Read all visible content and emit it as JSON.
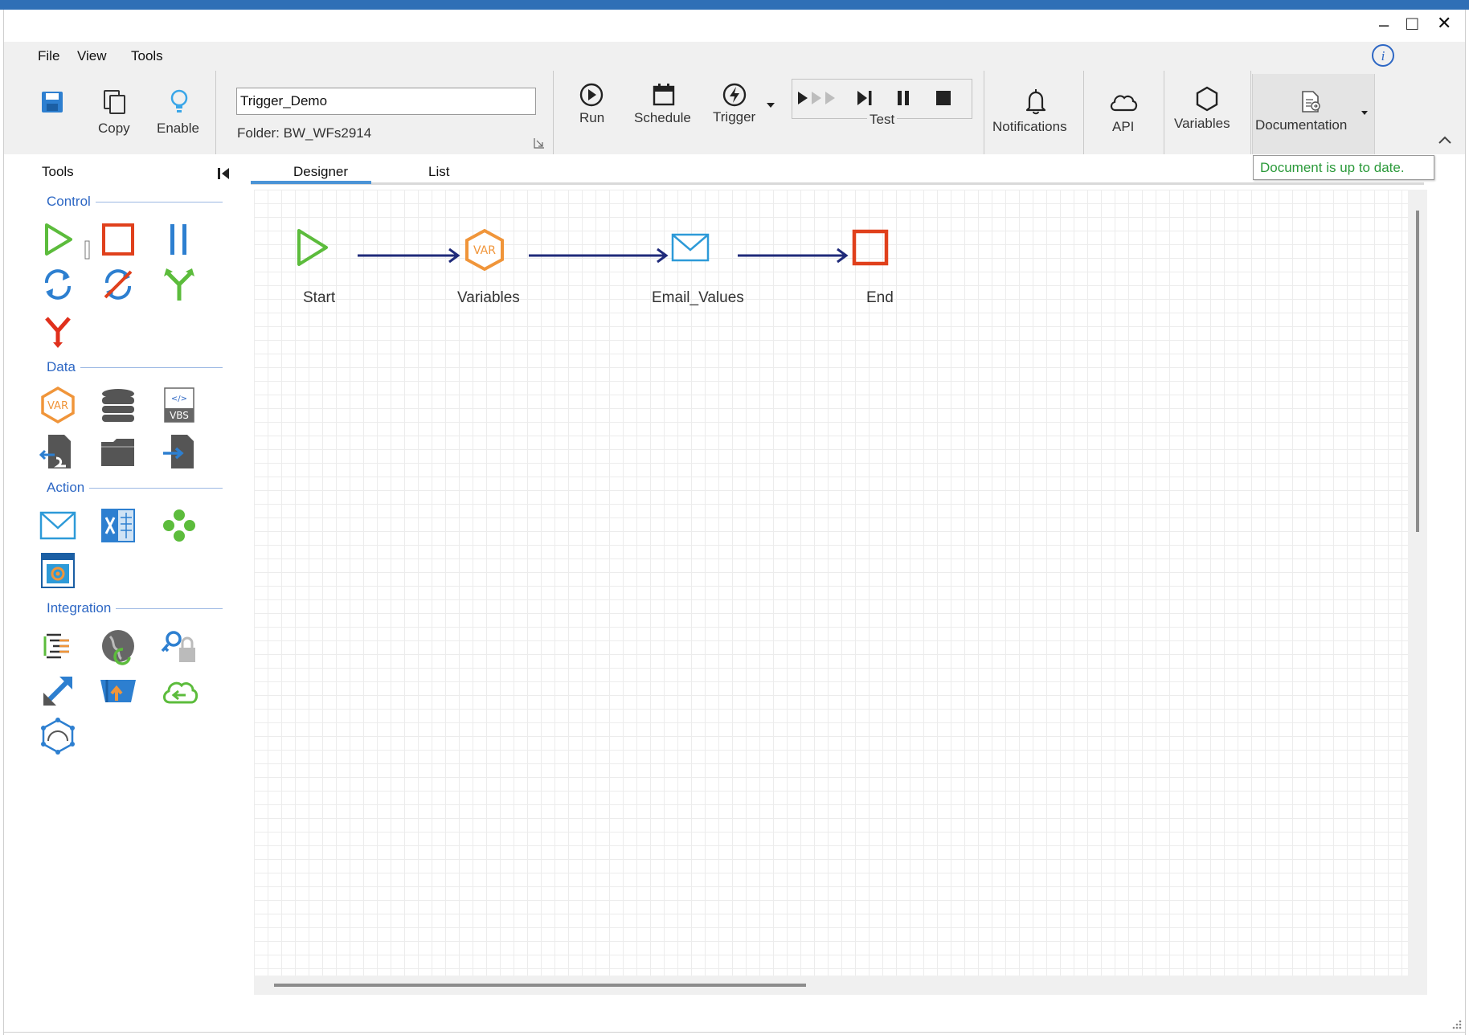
{
  "menu": {
    "file": "File",
    "view": "View",
    "tools": "Tools"
  },
  "window_controls": {
    "minimize": "–",
    "maximize": "□",
    "close": "✕"
  },
  "toolbar": {
    "copy_label": "Copy",
    "enable_label": "Enable",
    "workflow_name": "Trigger_Demo",
    "folder_label": "Folder:  BW_WFs2914",
    "run_label": "Run",
    "schedule_label": "Schedule",
    "trigger_label": "Trigger",
    "test_label": "Test",
    "notifications_label": "Notifications",
    "api_label": "API",
    "variables_label": "Variables",
    "documentation_label": "Documentation"
  },
  "tooltip": "Document is up to date.",
  "tools_panel": {
    "title": "Tools",
    "sections": {
      "control": "Control",
      "data": "Data",
      "action": "Action",
      "integration": "Integration"
    }
  },
  "tabs": {
    "designer": "Designer",
    "list": "List"
  },
  "flow": {
    "nodes": [
      {
        "label": "Start",
        "icon": "start-play-icon"
      },
      {
        "label": "Variables",
        "icon": "var-hexagon-icon"
      },
      {
        "label": "Email_Values",
        "icon": "email-envelope-icon"
      },
      {
        "label": "End",
        "icon": "end-square-icon"
      }
    ]
  },
  "colors": {
    "accent_blue": "#2d67c4",
    "start_green": "#5cbc3c",
    "stop_red": "#e0401c",
    "var_orange": "#f0953a",
    "arrow_navy": "#1f2a7a",
    "tooltip_green": "#2b9a3a"
  }
}
